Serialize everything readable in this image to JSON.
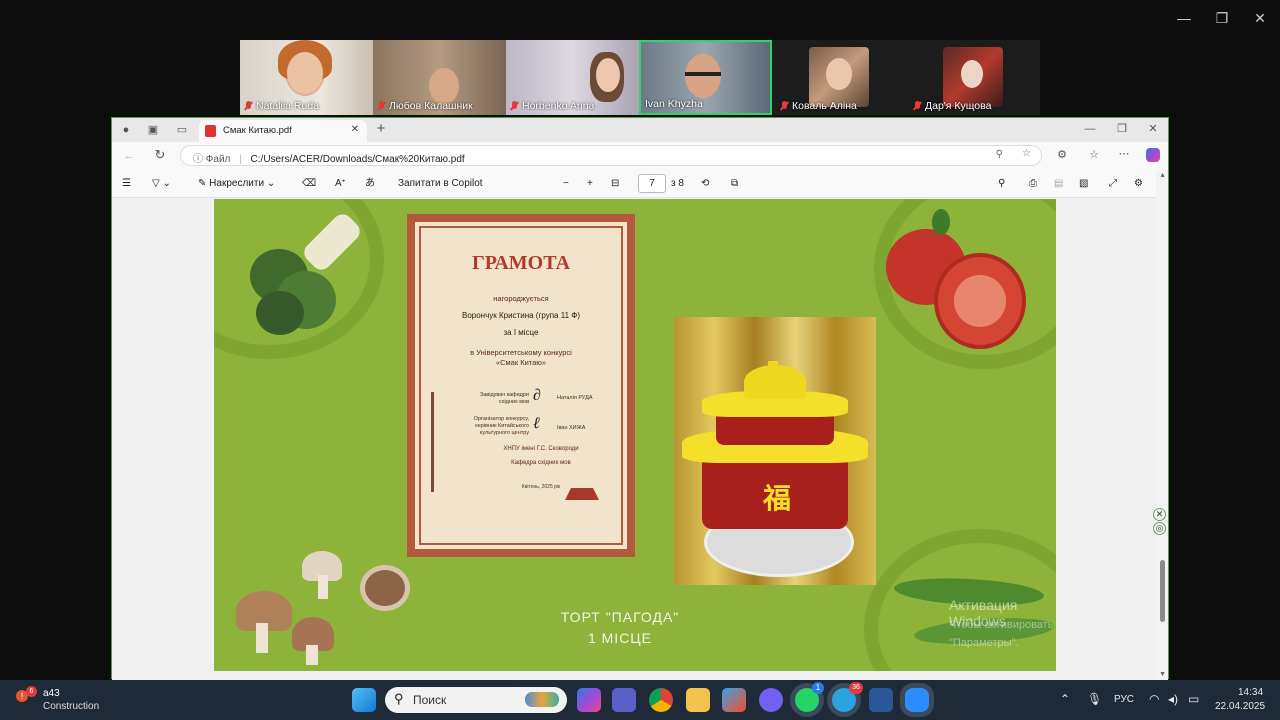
{
  "window_controls": {
    "minimize": "—",
    "maximize": "❐",
    "close": "✕"
  },
  "participants": [
    {
      "name": "Nataliia Ruda",
      "muted": true
    },
    {
      "name": "Любов Калашник",
      "muted": true
    },
    {
      "name": "Horbenko Anna",
      "muted": true
    },
    {
      "name": "Ivan Khyzha",
      "muted": false,
      "active": true
    },
    {
      "name": "Коваль Аліна",
      "muted": true
    },
    {
      "name": "Дар'я Кущова",
      "muted": true
    }
  ],
  "browser": {
    "tab_title": "Смак Китаю.pdf",
    "file_label": "Файл",
    "url": "C:/Users/ACER/Downloads/Смак%20Китаю.pdf",
    "toolbar": {
      "draw_label": "Накреслити",
      "copilot_label": "Запитати в Copilot",
      "page_current": "7",
      "page_total": "з 8"
    }
  },
  "slide": {
    "certificate": {
      "title": "ГРАМОТА",
      "awarded": "нагороджується",
      "recipient": "Ворончук Кристина (група 11 Ф)",
      "place": "за І місце",
      "contest_line1": "в Університетському конкурсі",
      "contest_line2": "«Смак Китаю»",
      "sig1_role_1": "Завідувач кафедри",
      "sig1_role_2": "східних мов",
      "sig1_name": "Наталія РУДА",
      "sig2_role_1": "Організатор конкурсу,",
      "sig2_role_2": "керівник Китайського",
      "sig2_role_3": "культурного центру",
      "sig2_name": "Іван ХИЖА",
      "university": "ХНПУ імені Г.С. Сковороди",
      "department": "Кафедра східних мов",
      "footer": "Квітень, 2025 рік"
    },
    "caption_line1": "ТОРТ \"ПАГОДА\"",
    "caption_line2": "1 МІСЦЕ",
    "cake_char": "福"
  },
  "watermark": {
    "title": "Активация Windows",
    "line1": "Чтобы активировать Windows, перейдите в раздел",
    "line2": "\"Параметры\"."
  },
  "taskbar": {
    "weather_temp": "a43",
    "weather_desc": "Construction",
    "weather_badge": "6",
    "search_placeholder": "Поиск",
    "lang": "РУС",
    "time": "14:34",
    "date": "22.04.2025",
    "whatsapp_badge": "1",
    "telegram_badge": "36"
  }
}
